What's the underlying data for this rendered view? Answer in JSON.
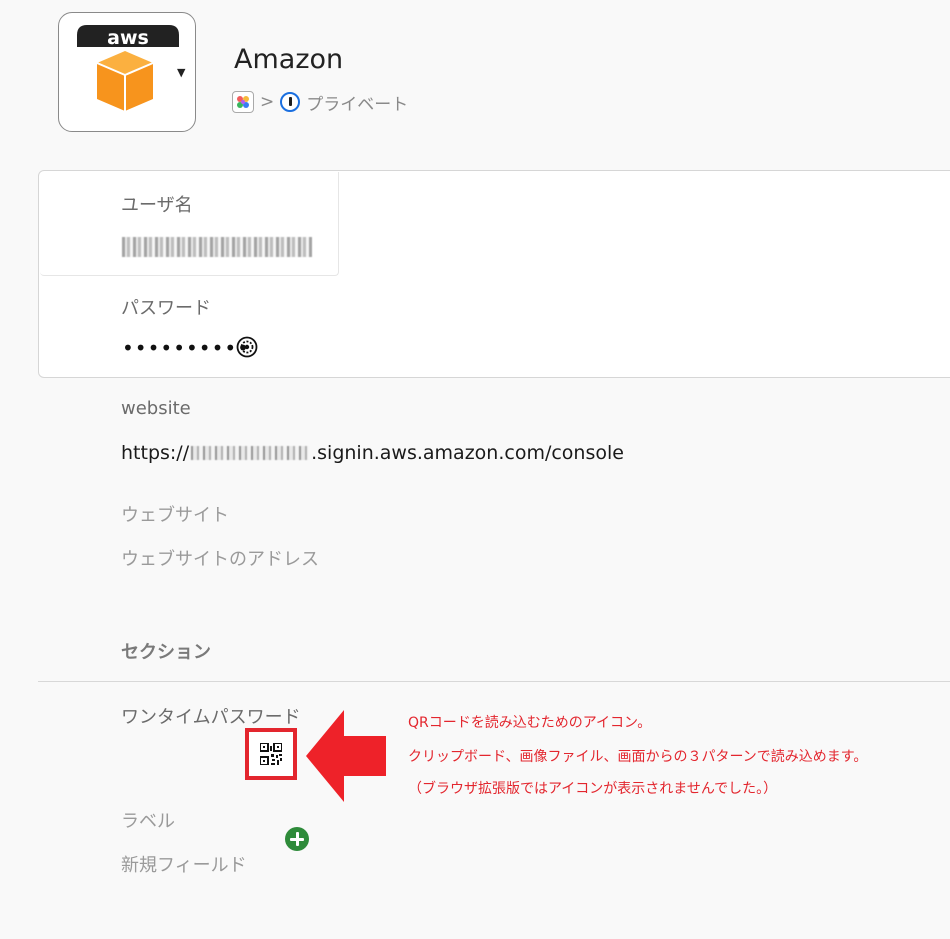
{
  "header": {
    "logo_text": "aws",
    "title": "Amazon",
    "breadcrumb_separator": ">",
    "vault_name": "プライベート"
  },
  "fields": {
    "username_label": "ユーザ名",
    "password_label": "パスワード",
    "password_masked": "••••••••••",
    "website_label": "website",
    "website_prefix": "https://",
    "website_suffix": ".signin.aws.amazon.com/console",
    "website_label_placeholder": "ウェブサイト",
    "website_address_placeholder": "ウェブサイトのアドレス",
    "section_header": "セクション",
    "otp_label": "ワンタイムパスワード",
    "label_placeholder": "ラベル",
    "new_field_placeholder": "新規フィールド"
  },
  "annotation": {
    "line1": "QRコードを読み込むためのアイコン。",
    "line2": "クリップボード、画像ファイル、画面からの３パターンで読み込めます。",
    "line3": "（ブラウザ拡張版ではアイコンが表示されませんでした。）"
  },
  "colors": {
    "accent_red": "#e3262e",
    "add_green": "#2e8b3a",
    "onepassword_blue": "#1a6fe0",
    "aws_orange": "#f7941d"
  }
}
